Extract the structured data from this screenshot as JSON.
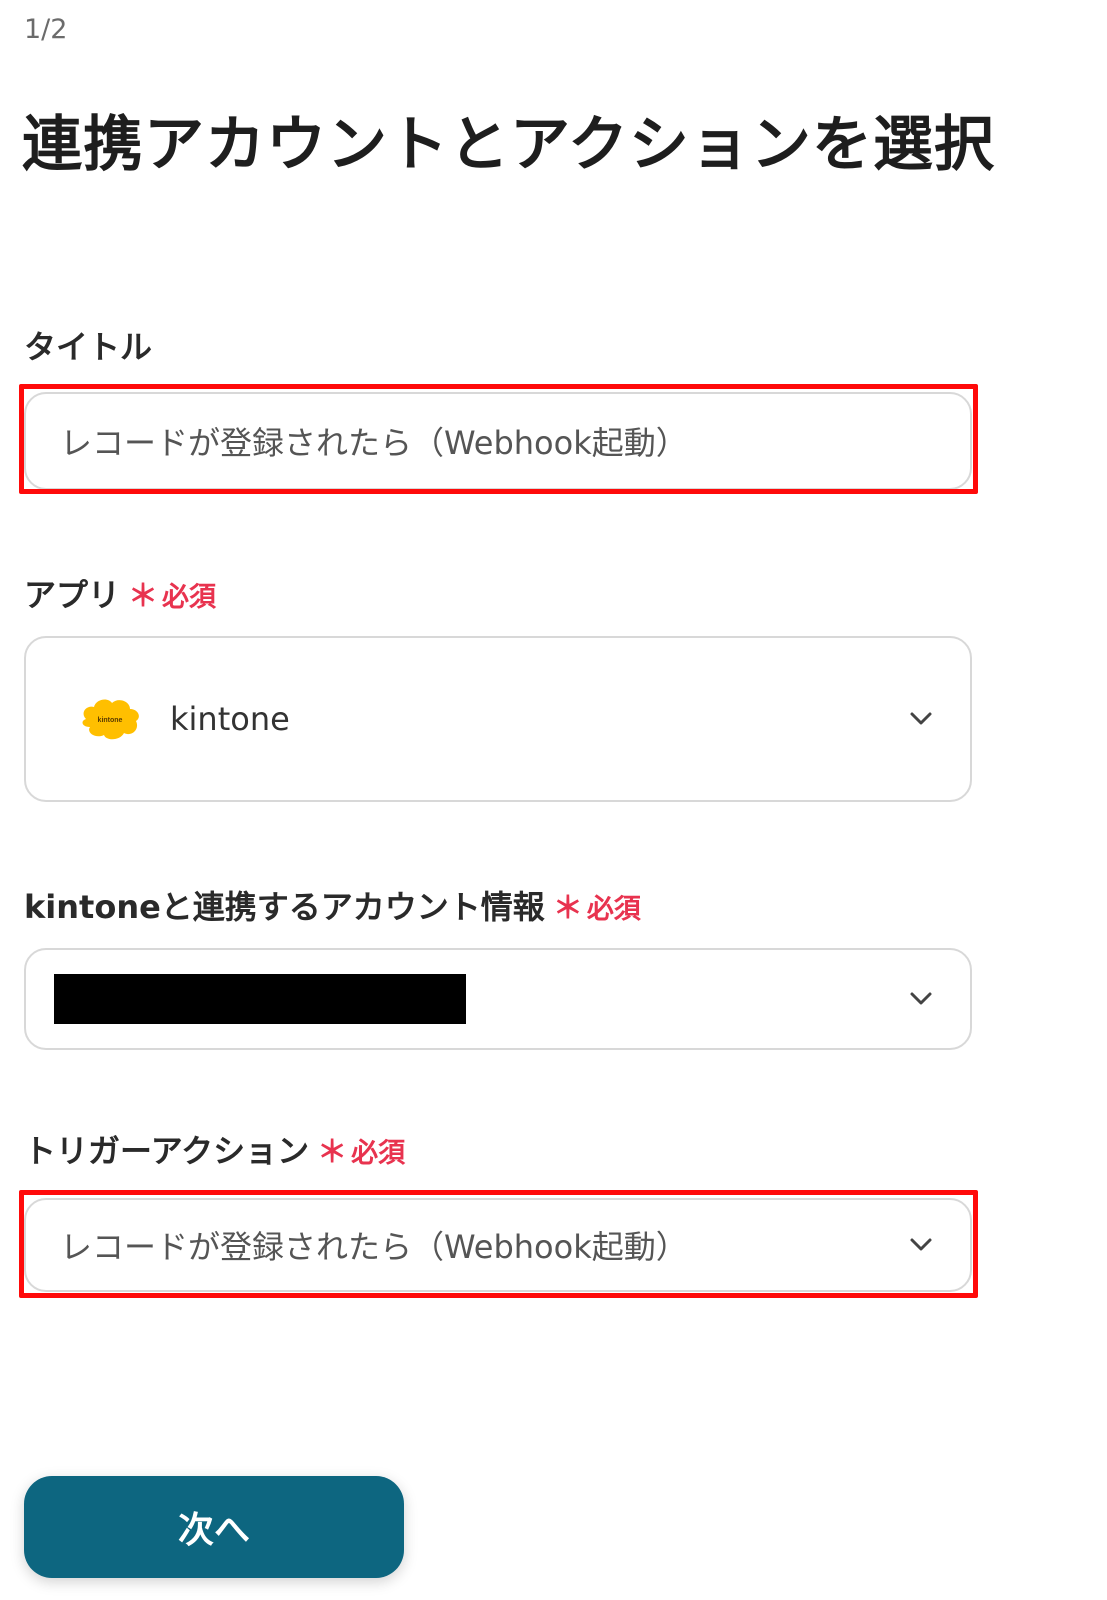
{
  "header": {
    "step": "1/2",
    "title": "連携アカウントとアクションを選択"
  },
  "required_mark": "必須",
  "required_star": "＊",
  "fields": {
    "title": {
      "label": "タイトル",
      "value": "レコードが登録されたら（Webhook起動）"
    },
    "app": {
      "label": "アプリ",
      "value": "kintone",
      "logo_text": "kintone"
    },
    "account": {
      "label": "kintoneと連携するアカウント情報"
    },
    "trigger": {
      "label": "トリガーアクション",
      "value": "レコードが登録されたら（Webhook起動）"
    }
  },
  "buttons": {
    "next": "次へ"
  },
  "colors": {
    "accent": "#0d6680",
    "required": "#e8334f",
    "highlight": "#ff0a0a",
    "kintone_yellow": "#ffbf00"
  }
}
